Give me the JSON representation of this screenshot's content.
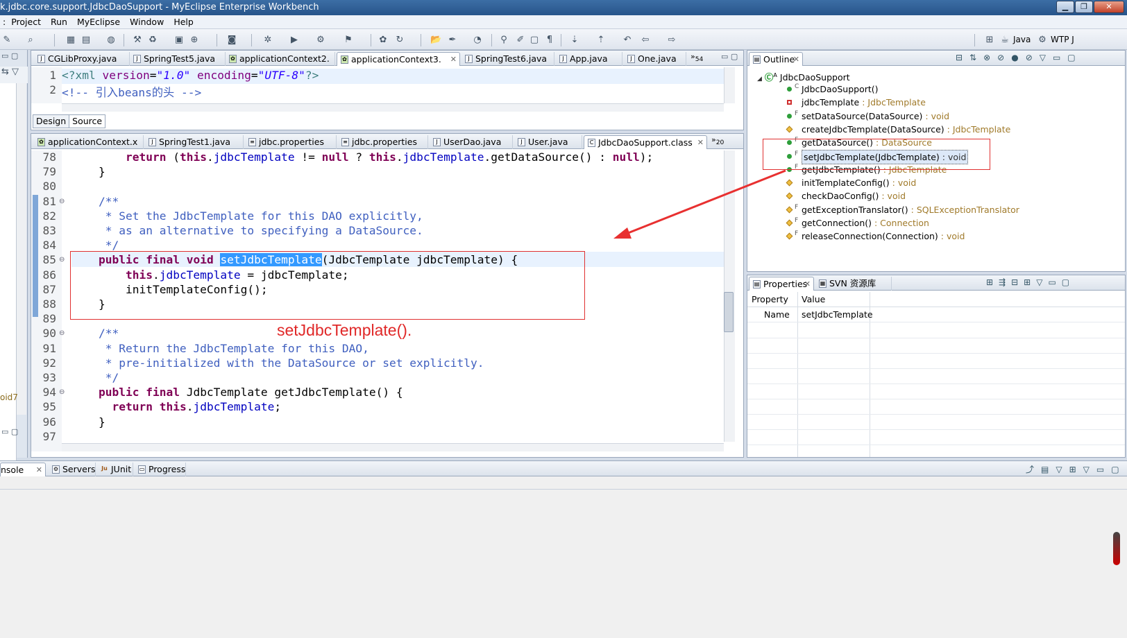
{
  "window": {
    "title": "k.jdbc.core.support.JdbcDaoSupport - MyEclipse Enterprise Workbench"
  },
  "menu": [
    "Project",
    "Run",
    "MyEclipse",
    "Window",
    "Help"
  ],
  "perspectives": [
    "Java",
    "WTP J"
  ],
  "xml_editor": {
    "tabs": [
      "CGLibProxy.java",
      "SpringTest5.java",
      "applicationContext2.",
      "applicationContext3.",
      "SpringTest6.java",
      "App.java",
      "One.java"
    ],
    "active_tab": "applicationContext3.",
    "overflow": "54",
    "line1_num": "1",
    "line2_num": "2",
    "line1": {
      "open": "<?xml ",
      "a1": "version",
      "eq": "=",
      "v1": "\"1.0\"",
      "sp": " ",
      "a2": "encoding",
      "eq2": "=",
      "v2": "\"UTF-8\"",
      "close": "?>"
    },
    "line2": "<!-- 引入beans的头 -->",
    "bottom_tabs": [
      "Design",
      "Source"
    ]
  },
  "java_editor": {
    "tabs": [
      "applicationContext.x",
      "SpringTest1.java",
      "jdbc.properties",
      "jdbc.properties",
      "UserDao.java",
      "User.java",
      "JdbcDaoSupport.class"
    ],
    "active_tab": "JdbcDaoSupport.class",
    "overflow": "20",
    "lines": [
      {
        "n": "78",
        "t": "        return (this.jdbcTemplate != null ? this.jdbcTemplate.getDataSource() : null);"
      },
      {
        "n": "79",
        "t": "    }"
      },
      {
        "n": "80",
        "t": ""
      },
      {
        "n": "81",
        "t": "    /**"
      },
      {
        "n": "82",
        "t": "     * Set the JdbcTemplate for this DAO explicitly,"
      },
      {
        "n": "83",
        "t": "     * as an alternative to specifying a DataSource."
      },
      {
        "n": "84",
        "t": "     */"
      },
      {
        "n": "85",
        "t": "    public final void setJdbcTemplate(JdbcTemplate jdbcTemplate) {"
      },
      {
        "n": "86",
        "t": "        this.jdbcTemplate = jdbcTemplate;"
      },
      {
        "n": "87",
        "t": "        initTemplateConfig();"
      },
      {
        "n": "88",
        "t": "    }"
      },
      {
        "n": "89",
        "t": ""
      },
      {
        "n": "90",
        "t": "    /**"
      },
      {
        "n": "91",
        "t": "     * Return the JdbcTemplate for this DAO,"
      },
      {
        "n": "92",
        "t": "     * pre-initialized with the DataSource or set explicitly."
      },
      {
        "n": "93",
        "t": "     */"
      },
      {
        "n": "94",
        "t": "    public final JdbcTemplate getJdbcTemplate() {"
      },
      {
        "n": "95",
        "t": "      return this.jdbcTemplate;"
      },
      {
        "n": "96",
        "t": "    }"
      },
      {
        "n": "97",
        "t": ""
      }
    ],
    "annotation": "setJdbcTemplate()."
  },
  "outline": {
    "title": "Outline",
    "root": "JdbcDaoSupport",
    "items": [
      {
        "name": "JdbcDaoSupport()",
        "type": "",
        "icon": "public-method",
        "mod": "C"
      },
      {
        "name": "jdbcTemplate",
        "type": " : JdbcTemplate",
        "icon": "private-field",
        "mod": ""
      },
      {
        "name": "setDataSource(DataSource)",
        "type": " : void",
        "icon": "public-method",
        "mod": "F"
      },
      {
        "name": "createJdbcTemplate(DataSource)",
        "type": " : JdbcTemplate",
        "icon": "protected-method",
        "mod": ""
      },
      {
        "name": "getDataSource()",
        "type": " : DataSource",
        "icon": "public-method",
        "mod": "F"
      },
      {
        "name": "setJdbcTemplate(JdbcTemplate)",
        "type": " : void",
        "icon": "public-method",
        "mod": "F"
      },
      {
        "name": "getJdbcTemplate()",
        "type": " : JdbcTemplate",
        "icon": "public-method",
        "mod": "F"
      },
      {
        "name": "initTemplateConfig()",
        "type": " : void",
        "icon": "protected-method",
        "mod": ""
      },
      {
        "name": "checkDaoConfig()",
        "type": " : void",
        "icon": "protected-method",
        "mod": ""
      },
      {
        "name": "getExceptionTranslator()",
        "type": " : SQLExceptionTranslator",
        "icon": "protected-method",
        "mod": "F"
      },
      {
        "name": "getConnection()",
        "type": " : Connection",
        "icon": "protected-method",
        "mod": "F"
      },
      {
        "name": "releaseConnection(Connection)",
        "type": " : void",
        "icon": "protected-method",
        "mod": "F"
      }
    ],
    "selected_index": 5
  },
  "properties": {
    "tabs": [
      "Properties",
      "SVN 资源库"
    ],
    "col_property": "Property",
    "col_value": "Value",
    "rows": [
      {
        "property": "Name",
        "value": "setJdbcTemplate"
      }
    ]
  },
  "bottom_panel": {
    "tabs": [
      "nsole",
      "Servers",
      "JUnit",
      "Progress"
    ]
  },
  "left_stub": {
    "label": "oid7"
  }
}
